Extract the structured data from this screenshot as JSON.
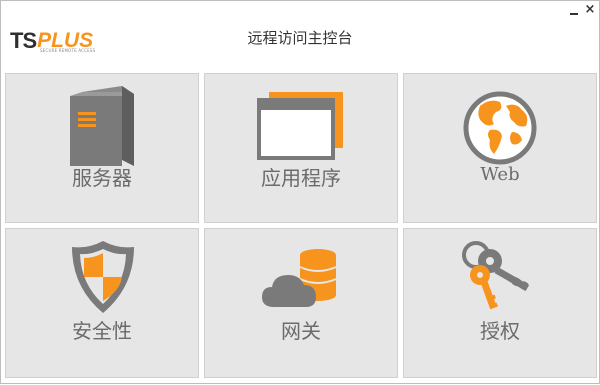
{
  "window": {
    "title": "远程访问主控台",
    "minimize_glyph": "—",
    "close_glyph": "×"
  },
  "logo": {
    "ts": "TS",
    "plus": "PLUS",
    "tagline": "SECURE REMOTE ACCESS"
  },
  "tiles": [
    {
      "label": "服务器",
      "icon": "server-icon"
    },
    {
      "label": "应用程序",
      "icon": "application-window-icon"
    },
    {
      "label": "Web",
      "icon": "globe-icon"
    },
    {
      "label": "安全性",
      "icon": "shield-icon"
    },
    {
      "label": "网关",
      "icon": "cloud-database-icon"
    },
    {
      "label": "授权",
      "icon": "keys-icon"
    }
  ],
  "colors": {
    "accent": "#f7941d",
    "icon_gray": "#7a7a7a",
    "tile_bg": "#e6e6e6",
    "label_gray": "#6b6b6b"
  }
}
